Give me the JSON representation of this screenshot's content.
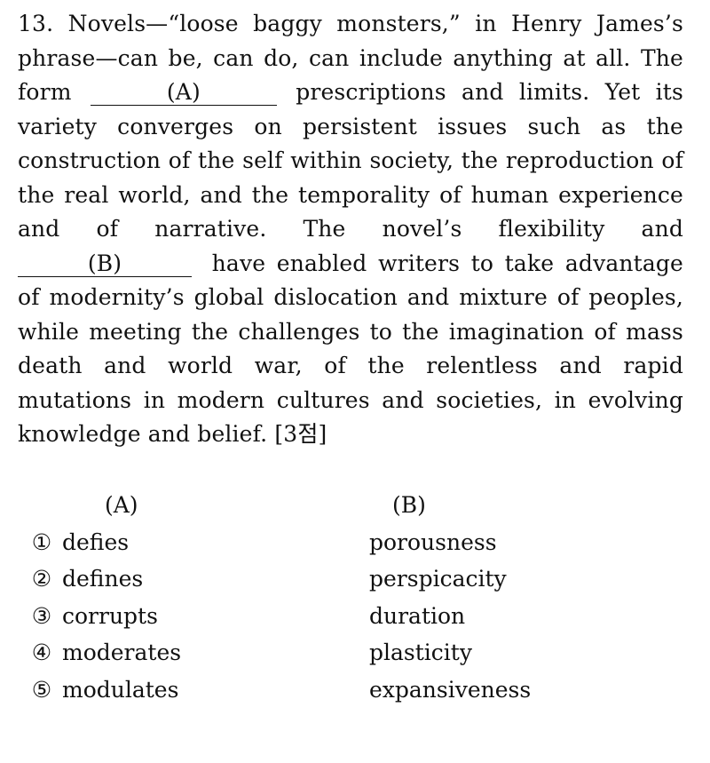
{
  "question": {
    "number": "13.",
    "seg1": "Novels—“loose baggy monsters,” in Henry James’s phrase—can be, can do, can include anything at all. The form",
    "blank_a": "(A)",
    "seg2": "prescriptions and limits. Yet its variety converges on persistent issues such as the construction of the self within society, the reproduction of the real world, and the temporality of human experience and of narrative. The novel’s flexibility and",
    "blank_b": "(B)",
    "seg3": "have enabled writers to take advantage of modernity’s global dislocation and mixture of peoples, while meeting the challenges to the imagination of mass death and world war, of the relentless and rapid mutations in modern cultures and societies, in evolving knowledge and belief.",
    "points": "[3점]"
  },
  "choices": {
    "header_a": "(A)",
    "header_b": "(B)",
    "options": [
      {
        "num": "①",
        "a": "defies",
        "b": "porousness"
      },
      {
        "num": "②",
        "a": "defines",
        "b": "perspicacity"
      },
      {
        "num": "③",
        "a": "corrupts",
        "b": "duration"
      },
      {
        "num": "④",
        "a": "moderates",
        "b": "plasticity"
      },
      {
        "num": "⑤",
        "a": "modulates",
        "b": "expansiveness"
      }
    ]
  }
}
